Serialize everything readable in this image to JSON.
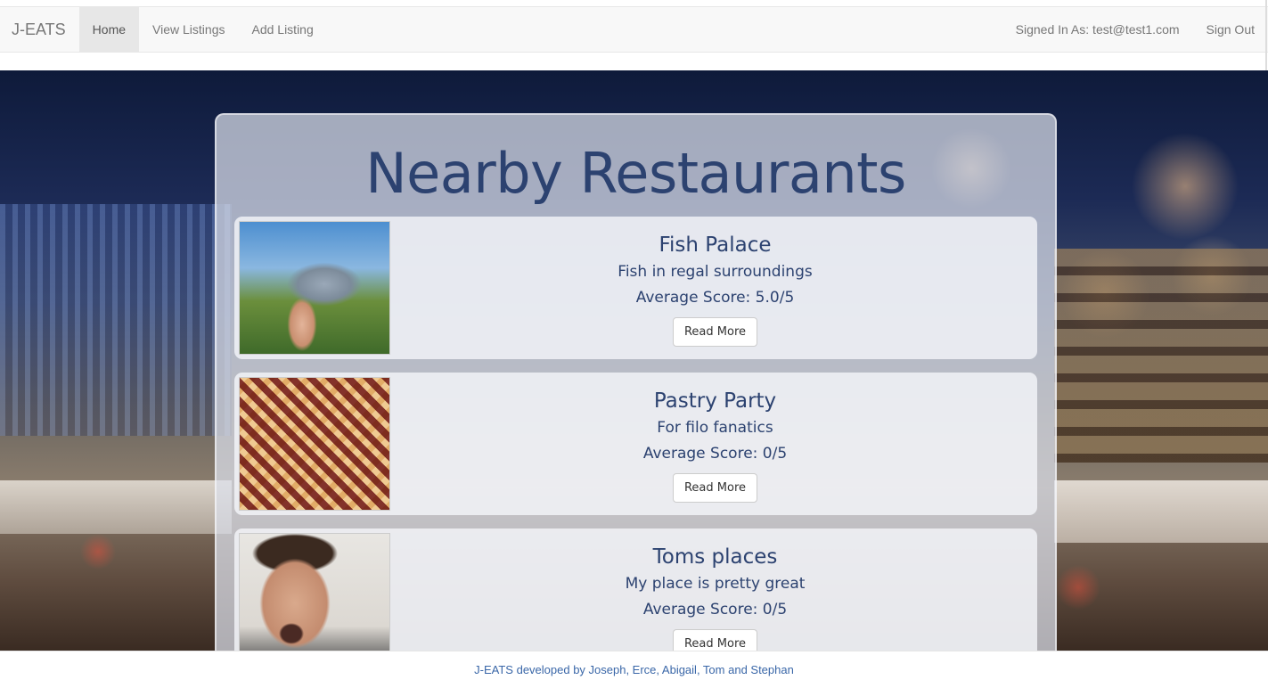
{
  "navbar": {
    "brand": "J-EATS",
    "links": [
      "Home",
      "View Listings",
      "Add Listing"
    ],
    "signed_in": "Signed In As: test@test1.com",
    "sign_out": "Sign Out"
  },
  "main": {
    "title": "Nearby Restaurants",
    "listings": [
      {
        "name": "Fish Palace",
        "description": "Fish in regal surroundings",
        "score": "Average Score: 5.0/5",
        "button": "Read More"
      },
      {
        "name": "Pastry Party",
        "description": "For filo fanatics",
        "score": "Average Score: 0/5",
        "button": "Read More"
      },
      {
        "name": "Toms places",
        "description": "My place is pretty great",
        "score": "Average Score: 0/5",
        "button": "Read More"
      }
    ]
  },
  "footer": {
    "credit": "J-EATS developed by Joseph, Erce, Abigail, Tom and Stephan"
  },
  "colors": {
    "heading": "#2c4270",
    "footer_link": "#3a67a8",
    "navbar_bg": "#f8f8f8"
  }
}
